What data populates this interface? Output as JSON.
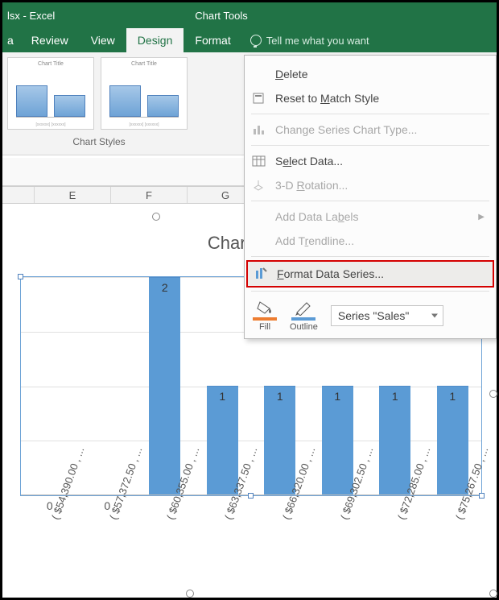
{
  "titlebar": {
    "doc": "lsx - Excel",
    "chart_tools": "Chart Tools"
  },
  "tabs": {
    "t0": "a",
    "review": "Review",
    "view": "View",
    "design": "Design",
    "format": "Format",
    "tellme": "Tell me what you want"
  },
  "ribbon": {
    "thumb_title": "Chart Title",
    "chart_styles": "Chart Styles"
  },
  "columns": {
    "e": "E",
    "f": "F",
    "g": "G"
  },
  "context": {
    "delete": "elete",
    "reset": "Reset to ",
    "reset2": "atch Style",
    "change_type": "Change Series Chart Type...",
    "select_data": "ect Data...",
    "rotation": "3-D ",
    "rotation2": "otation...",
    "add_labels": "Add Data La",
    "add_labels2": "els",
    "add_trend": "Add T",
    "add_trend2": "endline...",
    "format_series": "ormat Data Series...",
    "fill": "Fill",
    "outline": "Outline",
    "series_val": "Series \"Sales\""
  },
  "chart_data": {
    "type": "bar",
    "title": "Chart Title",
    "categories": [
      "( $54,390.00 , ...",
      "( $57,372.50 , ...",
      "( $60,355.00 , ...",
      "( $63,337.50 , ...",
      "( $66,320.00 , ...",
      "( $69,302.50 , ...",
      "( $72,285.00 , ...",
      "( $75,267.50 , ..."
    ],
    "values": [
      0,
      0,
      2,
      1,
      1,
      1,
      1,
      1
    ],
    "ylim": [
      0,
      2
    ]
  }
}
